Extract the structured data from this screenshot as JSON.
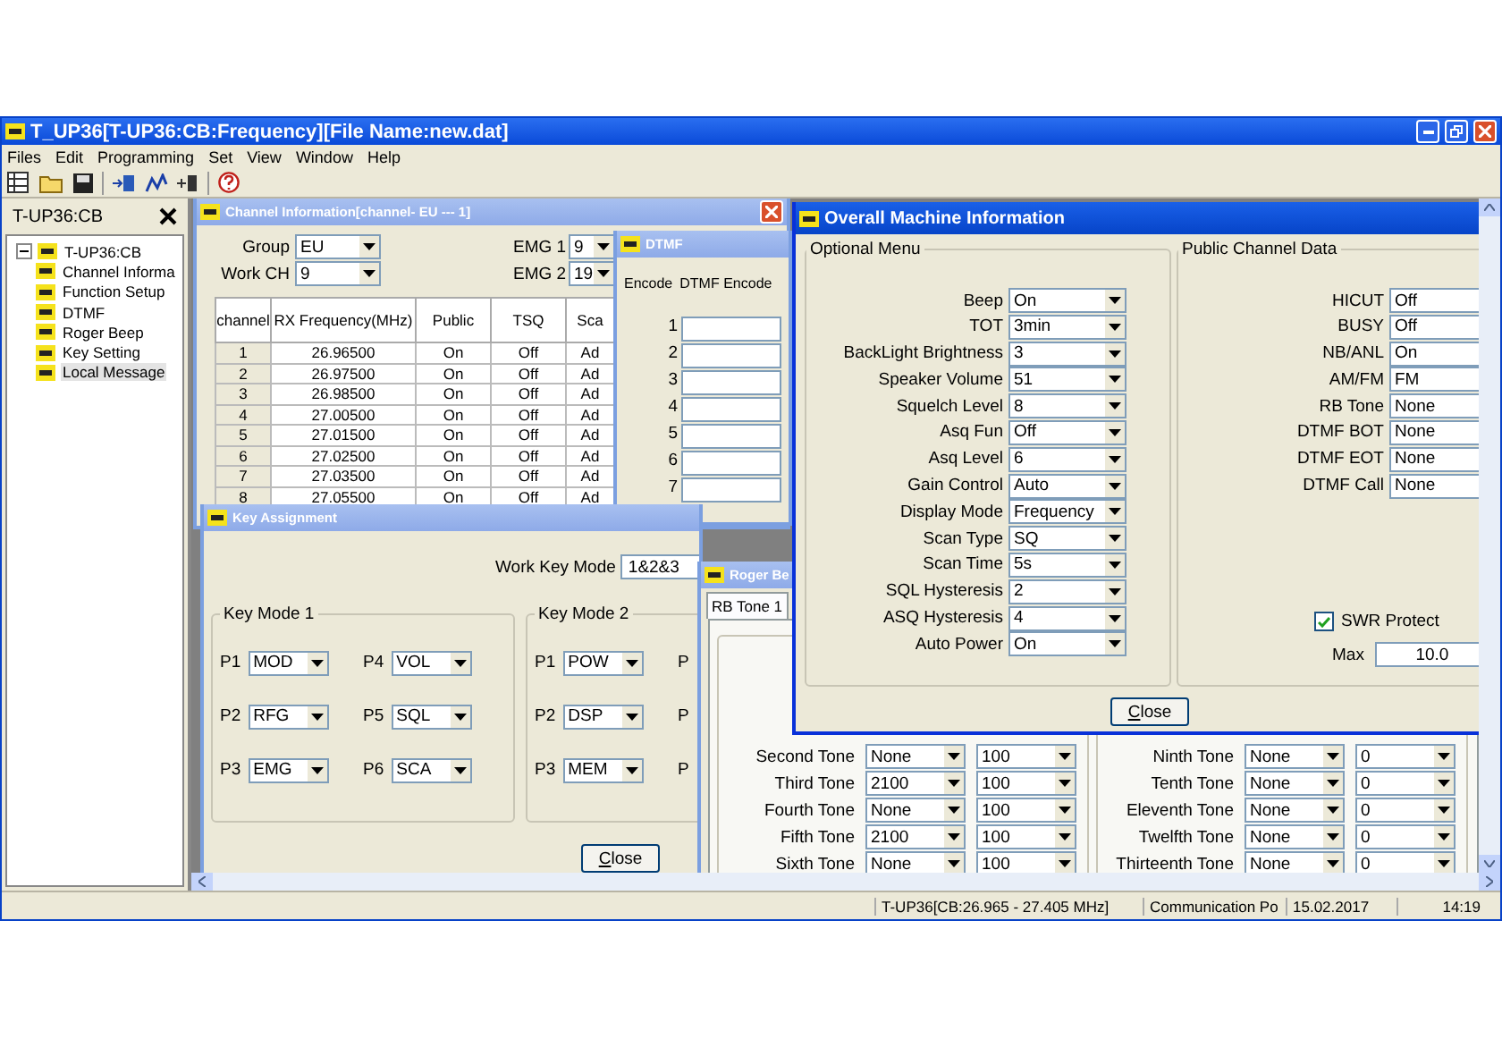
{
  "window": {
    "title": "T_UP36[T-UP36:CB:Frequency][File Name:new.dat]"
  },
  "menu": [
    "Files",
    "Edit",
    "Programming",
    "Set",
    "View",
    "Window",
    "Help"
  ],
  "tree_panel": {
    "title": "T-UP36:CB",
    "root": {
      "label": "T-UP36:CB",
      "expanded": true,
      "children": [
        {
          "label": "Channel Informa",
          "selected": false
        },
        {
          "label": "Function Setup",
          "selected": false
        },
        {
          "label": "DTMF",
          "selected": false
        },
        {
          "label": "Roger Beep",
          "selected": false
        },
        {
          "label": "Key Setting",
          "selected": false
        },
        {
          "label": "Local Message",
          "selected": true
        }
      ]
    }
  },
  "channel_window": {
    "title": "Channel Information[channel- EU --- 1]",
    "active": false,
    "fields": [
      {
        "label": "Group",
        "value": "EU"
      },
      {
        "label": "Work CH",
        "value": "9"
      }
    ],
    "emg": [
      {
        "label": "EMG 1",
        "value": "9"
      },
      {
        "label": "EMG 2",
        "value": "19"
      }
    ],
    "table": {
      "columns": [
        "channel",
        "RX Frequency(MHz)",
        "Public",
        "TSQ",
        "Sca"
      ],
      "rows": [
        [
          "1",
          "26.96500",
          "On",
          "Off",
          "Ad"
        ],
        [
          "2",
          "26.97500",
          "On",
          "Off",
          "Ad"
        ],
        [
          "3",
          "26.98500",
          "On",
          "Off",
          "Ad"
        ],
        [
          "4",
          "27.00500",
          "On",
          "Off",
          "Ad"
        ],
        [
          "5",
          "27.01500",
          "On",
          "Off",
          "Ad"
        ],
        [
          "6",
          "27.02500",
          "On",
          "Off",
          "Ad"
        ],
        [
          "7",
          "27.03500",
          "On",
          "Off",
          "Ad"
        ],
        [
          "8",
          "27.05500",
          "On",
          "Off",
          "Ad"
        ]
      ]
    }
  },
  "dtmf_window": {
    "title": "DTMF",
    "active": false,
    "columns": [
      "Encode",
      "DTMF Encode"
    ],
    "rows": [
      "1",
      "2",
      "3",
      "4",
      "5",
      "6",
      "7"
    ]
  },
  "key_window": {
    "title": "Key Assignment",
    "active": false,
    "work_key_mode": {
      "label": "Work Key Mode",
      "value": "1&2&3"
    },
    "groups": [
      {
        "title": "Key Mode 1",
        "keys": [
          {
            "label": "P1",
            "value": "MOD"
          },
          {
            "label": "P2",
            "value": "RFG"
          },
          {
            "label": "P3",
            "value": "EMG"
          },
          {
            "label": "P4",
            "value": "VOL"
          },
          {
            "label": "P5",
            "value": "SQL"
          },
          {
            "label": "P6",
            "value": "SCA"
          }
        ]
      },
      {
        "title": "Key Mode 2",
        "keys": [
          {
            "label": "P1",
            "value": "POW"
          },
          {
            "label": "P2",
            "value": "DSP"
          },
          {
            "label": "P3",
            "value": "MEM"
          },
          {
            "label": "P"
          },
          {
            "label": "P"
          },
          {
            "label": "P"
          }
        ]
      }
    ],
    "close": "Close"
  },
  "roger_window": {
    "title": "Roger Be",
    "active": false,
    "tabs": [
      {
        "label": "RB Tone 1",
        "selected": true
      }
    ],
    "columns": [
      {
        "rows": [
          {
            "label": "Second Tone",
            "tone": "None",
            "length": "100"
          },
          {
            "label": "Third Tone",
            "tone": "2100",
            "length": "100"
          },
          {
            "label": "Fourth Tone",
            "tone": "None",
            "length": "100"
          },
          {
            "label": "Fifth Tone",
            "tone": "2100",
            "length": "100"
          },
          {
            "label": "Sixth Tone",
            "tone": "None",
            "length": "100"
          }
        ]
      },
      {
        "rows": [
          {
            "label": "Ninth Tone",
            "tone": "None",
            "length": "0"
          },
          {
            "label": "Tenth Tone",
            "tone": "None",
            "length": "0"
          },
          {
            "label": "Eleventh Tone",
            "tone": "None",
            "length": "0"
          },
          {
            "label": "Twelfth Tone",
            "tone": "None",
            "length": "0"
          },
          {
            "label": "Thirteenth Tone",
            "tone": "None",
            "length": "0"
          }
        ]
      }
    ]
  },
  "overall_window": {
    "title": "Overall Machine Information",
    "active": true,
    "groups": [
      {
        "title": "Optional Menu",
        "fields": [
          {
            "label": "Beep",
            "value": "On"
          },
          {
            "label": "TOT",
            "value": "3min"
          },
          {
            "label": "BackLight Brightness",
            "value": "3"
          },
          {
            "label": "Speaker Volume",
            "value": "51"
          },
          {
            "label": "Squelch Level",
            "value": "8"
          },
          {
            "label": "Asq Fun",
            "value": "Off"
          },
          {
            "label": "Asq Level",
            "value": "6"
          },
          {
            "label": "Gain Control",
            "value": "Auto"
          },
          {
            "label": "Display Mode",
            "value": "Frequency"
          },
          {
            "label": "Scan Type",
            "value": "SQ"
          },
          {
            "label": "Scan Time",
            "value": "5s"
          },
          {
            "label": "SQL Hysteresis",
            "value": "2"
          },
          {
            "label": "ASQ Hysteresis",
            "value": "4"
          },
          {
            "label": "Auto Power",
            "value": "On"
          }
        ]
      },
      {
        "title": "Public Channel Data",
        "fields": [
          {
            "label": "HICUT",
            "value": "Off"
          },
          {
            "label": "BUSY",
            "value": "Off"
          },
          {
            "label": "NB/ANL",
            "value": "On"
          },
          {
            "label": "AM/FM",
            "value": "FM"
          },
          {
            "label": "RB Tone",
            "value": "None"
          },
          {
            "label": "DTMF BOT",
            "value": "None"
          },
          {
            "label": "DTMF EOT",
            "value": "None"
          },
          {
            "label": "DTMF Call",
            "value": "None"
          }
        ]
      }
    ],
    "swr_protect": {
      "label": "SWR Protect",
      "checked": true
    },
    "max": {
      "label": "Max",
      "value": "10.0"
    },
    "close": "Close"
  },
  "status_bar": [
    "T-UP36[CB:26.965 - 27.405 MHz]",
    "Communication Po",
    "15.02.2017",
    "14:19"
  ]
}
